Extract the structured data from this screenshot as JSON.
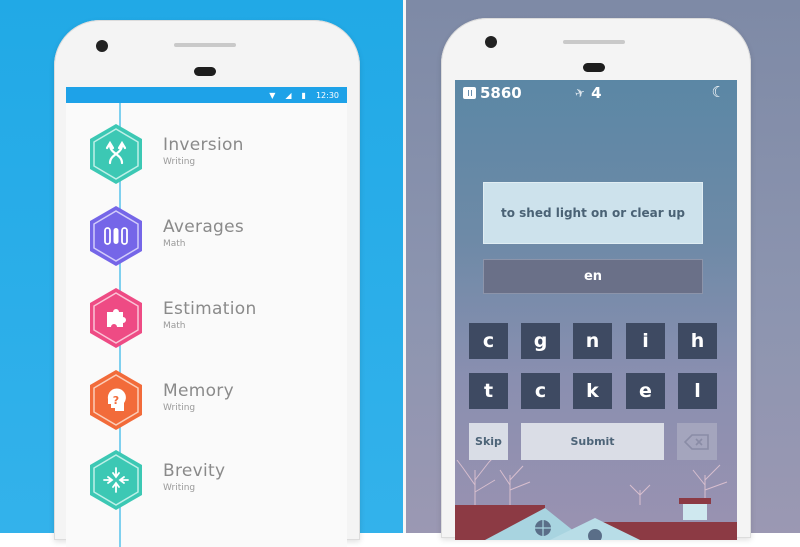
{
  "colors": {
    "left_background": "#21a9e6",
    "right_background": "#7e8aa6",
    "status_bar": "#1ea2e8",
    "timeline": "#7fd0ef",
    "key_background": "#3e4a62",
    "clue_background": "#cde2ec",
    "answer_background": "#6a7088"
  },
  "left_app": {
    "status_bar": {
      "wifi_icon": "wifi-icon",
      "signal_icon": "signal-icon",
      "battery_icon": "battery-icon",
      "time": "12:30"
    },
    "skills": [
      {
        "name": "Inversion",
        "category": "Writing",
        "icon": "crossing-arrows-icon",
        "color": "#3cc8b4"
      },
      {
        "name": "Averages",
        "category": "Math",
        "icon": "bars-icon",
        "color": "#7566e8"
      },
      {
        "name": "Estimation",
        "category": "Math",
        "icon": "puzzle-piece-icon",
        "color": "#ee4b84"
      },
      {
        "name": "Memory",
        "category": "Writing",
        "icon": "head-question-icon",
        "color": "#f26b3a"
      },
      {
        "name": "Brevity",
        "category": "Writing",
        "icon": "converging-arrows-icon",
        "color": "#3cc8b4"
      }
    ]
  },
  "right_app": {
    "header": {
      "score_icon": "book-icon",
      "score": "5860",
      "streak_icon": "bird-icon",
      "streak": "4",
      "theme_icon": "moon-icon"
    },
    "clue": "to shed light on or clear up",
    "answer": "en",
    "letters_row1": [
      "c",
      "g",
      "n",
      "i",
      "h"
    ],
    "letters_row2": [
      "t",
      "c",
      "k",
      "e",
      "l"
    ],
    "skip_label": "Skip",
    "submit_label": "Submit",
    "backspace_icon": "backspace-icon"
  }
}
